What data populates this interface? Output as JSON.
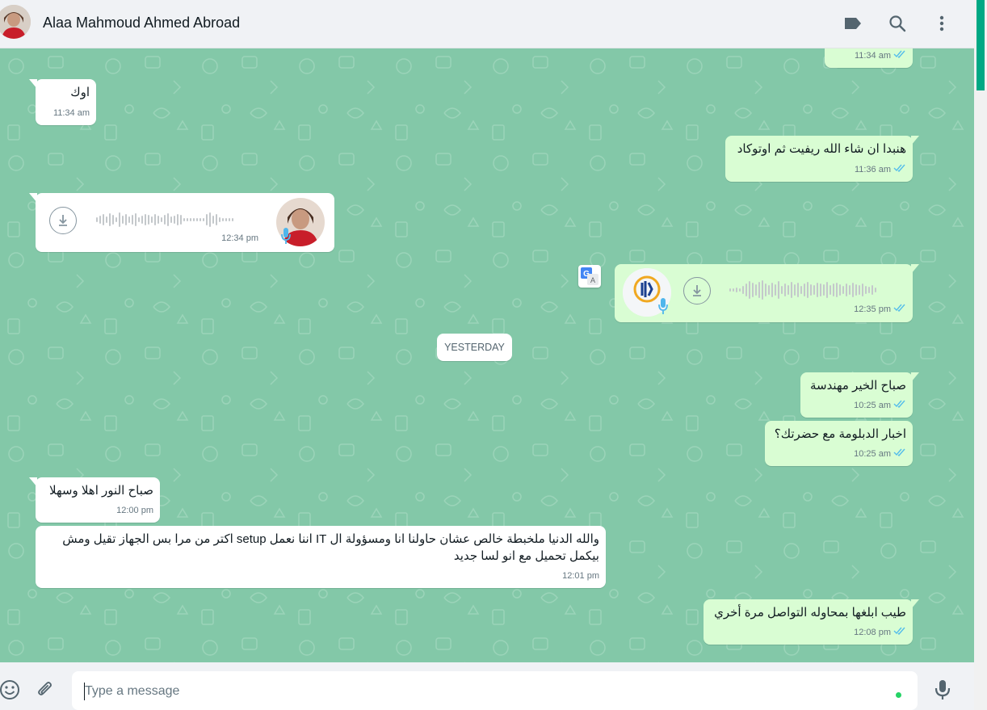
{
  "header": {
    "contact_name": "Alaa Mahmoud Ahmed Abroad",
    "icons": [
      "label-icon",
      "search-icon",
      "menu-icon"
    ]
  },
  "messages": {
    "m0": {
      "time": "11:34 am",
      "direction": "out"
    },
    "m1": {
      "text": "اوك",
      "time": "11:34 am",
      "direction": "in"
    },
    "m2": {
      "text": "هنبدا ان شاء الله ريفيت ثم اوتوكاد",
      "time": "11:36 am",
      "direction": "out"
    },
    "m3": {
      "type": "voice",
      "time": "12:34 pm",
      "direction": "in"
    },
    "m4": {
      "type": "voice",
      "time": "12:35 pm",
      "direction": "out",
      "avatar_logo": "RADIANCE GROUP"
    },
    "m5": {
      "text": "صباح الخير مهندسة",
      "time": "10:25 am",
      "direction": "out"
    },
    "m6": {
      "text": "اخبار الدبلومة مع حضرتك؟",
      "time": "10:25 am",
      "direction": "out"
    },
    "m7": {
      "text": "صباح النور اهلا وسهلا",
      "time": "12:00 pm",
      "direction": "in"
    },
    "m8": {
      "text": "والله الدنيا ملخبطة خالص عشان حاولنا انا ومسؤولة ال IT اننا نعمل setup اكتر من مرا بس الجهاز تقيل ومش بيكمل تحميل مع انو لسا جديد",
      "time": "12:01 pm",
      "direction": "in"
    },
    "m9": {
      "text": "طيب ابلغها بمحاوله التواصل مرة أخري",
      "time": "12:08 pm",
      "direction": "out"
    }
  },
  "date_divider": "YESTERDAY",
  "composer": {
    "placeholder": "Type a message",
    "icons": [
      "emoji-icon",
      "attach-icon",
      "mic-icon"
    ]
  },
  "colors": {
    "chat_bg": "#83c8a8",
    "incoming": "#ffffff",
    "outgoing": "#d9fdd3",
    "tick_blue": "#53bdeb",
    "accent": "#00a884"
  }
}
